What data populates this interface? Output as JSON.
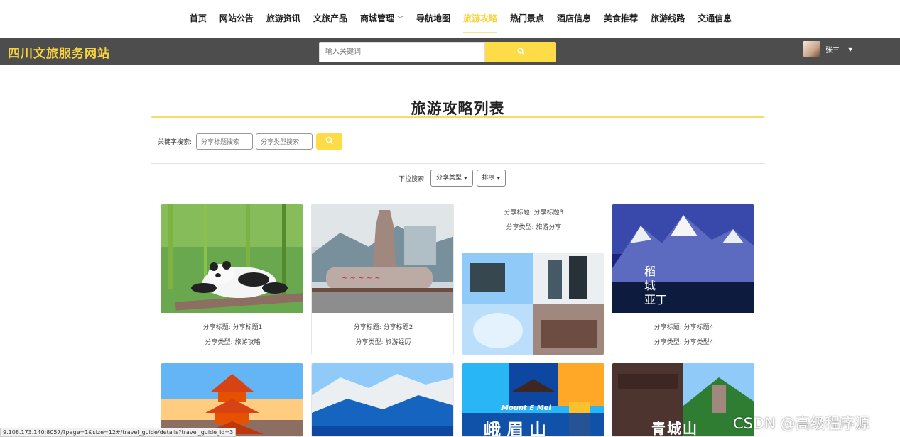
{
  "nav": {
    "items": [
      {
        "label": "首页"
      },
      {
        "label": "网站公告"
      },
      {
        "label": "旅游资讯"
      },
      {
        "label": "文旅产品"
      },
      {
        "label": "商城管理"
      },
      {
        "label": "导航地图"
      },
      {
        "label": "旅游攻略"
      },
      {
        "label": "热门景点"
      },
      {
        "label": "酒店信息"
      },
      {
        "label": "美食推荐"
      },
      {
        "label": "旅游线路"
      },
      {
        "label": "交通信息"
      }
    ],
    "active_color": "#f7d33e"
  },
  "header": {
    "brand": "四川文旅服务网站",
    "search_placeholder": "输入关键词",
    "user_name": "张三",
    "bg_color": "#4d4d4d",
    "accent_color": "#fddc48"
  },
  "page": {
    "title": "旅游攻略列表",
    "keyword_label": "关键字搜索:",
    "title_placeholder": "分享标题搜索",
    "type_placeholder": "分享类型搜索",
    "dropdown_label": "下拉搜索:",
    "dropdown_type": "分享类型",
    "dropdown_sort": "排序"
  },
  "cards": [
    {
      "title_line": "分享标题: 分享标题1",
      "type_line": "分享类型: 旅游攻略",
      "image": "panda"
    },
    {
      "title_line": "分享标题: 分享标题2",
      "type_line": "分享类型: 旅游经历",
      "image": "monument"
    },
    {
      "title_line": "分享标题: 分享标题3",
      "type_line": "分享类型: 旅游分享",
      "image": "collage"
    },
    {
      "title_line": "分享标题: 分享标题4",
      "type_line": "分享类型: 分享类型4",
      "image": "snow-mountain"
    }
  ],
  "cards_row2": [
    {
      "image": "pagoda"
    },
    {
      "image": "mountains"
    },
    {
      "image": "emei",
      "img_text": "峨眉山",
      "img_sub": "Mount E Mei"
    },
    {
      "image": "qingcheng",
      "img_text": "青城山"
    }
  ],
  "status_bar": "9.108.173.140:8057/?page=1&size=12#/travel_guide/details?travel_guide_id=3",
  "watermark": "CSDN @高级程序源"
}
